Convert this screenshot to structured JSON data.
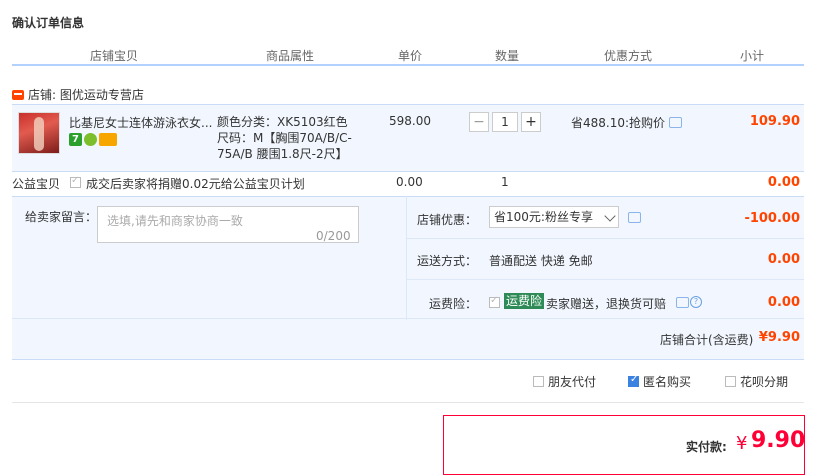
{
  "title": "确认订单信息",
  "headers": [
    "店铺宝贝",
    "商品属性",
    "单价",
    "数量",
    "优惠方式",
    "小计"
  ],
  "store": {
    "label": "店铺:",
    "name": "图优运动专营店"
  },
  "item": {
    "name": "比基尼女士连体游泳衣女...",
    "badge1": "7",
    "attr_line1": "颜色分类：XK5103红色",
    "attr_line2": "尺码：M【胸围70A/B/C-75A/B 腰围1.8尺-2尺】",
    "price": "598.00",
    "qty": "1",
    "qty_minus": "−",
    "qty_plus": "+",
    "promo": "省488.10:抢购价",
    "subtotal": "109.90"
  },
  "charity": {
    "label": "公益宝贝",
    "text": "成交后卖家将捐赠0.02元给公益宝贝计划",
    "price": "0.00",
    "qty": "1",
    "subtotal": "0.00"
  },
  "message": {
    "label": "给卖家留言：",
    "placeholder": "选填,请先和商家协商一致",
    "count": "0/200"
  },
  "discount": {
    "label": "店铺优惠：",
    "selected": "省100元:粉丝专享",
    "amount": "-100.00"
  },
  "shipping": {
    "label": "运送方式：",
    "value": "普通配送 快递 免邮",
    "amount": "0.00"
  },
  "insurance": {
    "label": "运费险：",
    "tag": "运费险",
    "text": "卖家赠送，退换货可赔",
    "amount": "0.00",
    "help": "?"
  },
  "store_total": {
    "label": "店铺合计(含运费)",
    "amount": "¥9.90"
  },
  "options": [
    {
      "label": "朋友代付",
      "checked": false
    },
    {
      "label": "匿名购买",
      "checked": true
    },
    {
      "label": "花呗分期",
      "checked": false
    }
  ],
  "payment": {
    "label": "实付款:",
    "currency": "¥",
    "amount": "9.90"
  },
  "colors": {
    "accent": "#ff4400",
    "pay_red": "#ff0036",
    "row_bg": "#f2f7ff",
    "header_line": "#b2d1ff"
  }
}
